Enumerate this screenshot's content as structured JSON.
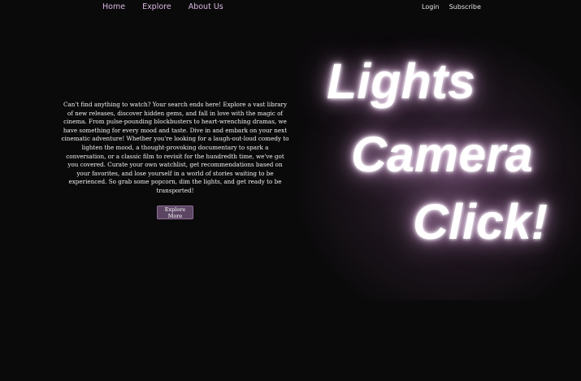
{
  "nav": {
    "left_links": [
      "Home",
      "Explore",
      "About Us"
    ],
    "right_links": [
      "Login",
      "Subscribe"
    ]
  },
  "hero": {
    "headline_lines": [
      "Lights",
      "Camera",
      "Click!"
    ],
    "description": "Can't find anything to watch? Your search ends here! Explore a vast library of new releases, discover hidden gems, and fall in love with the magic of cinema. From pulse-pounding blockbusters to heart-wrenching dramas, we have something for every mood and taste. Dive in and embark on your next cinematic adventure! Whether you're looking for a laugh-out-loud comedy to lighten the mood, a thought-provoking documentary to spark a conversation, or a classic film to revisit for the hundredth time, we've got you covered. Curate your own watchlist, get recommendations based on your favorites, and lose yourself in a world of stories waiting to be experienced. So grab some popcorn, dim the lights, and get ready to be transported!",
    "cta_label": "Explore More"
  },
  "colors": {
    "background": "#0b0a0b",
    "accent": "#5c4563",
    "nav_link": "#d8b8e0",
    "glow": "#c89ac8"
  }
}
